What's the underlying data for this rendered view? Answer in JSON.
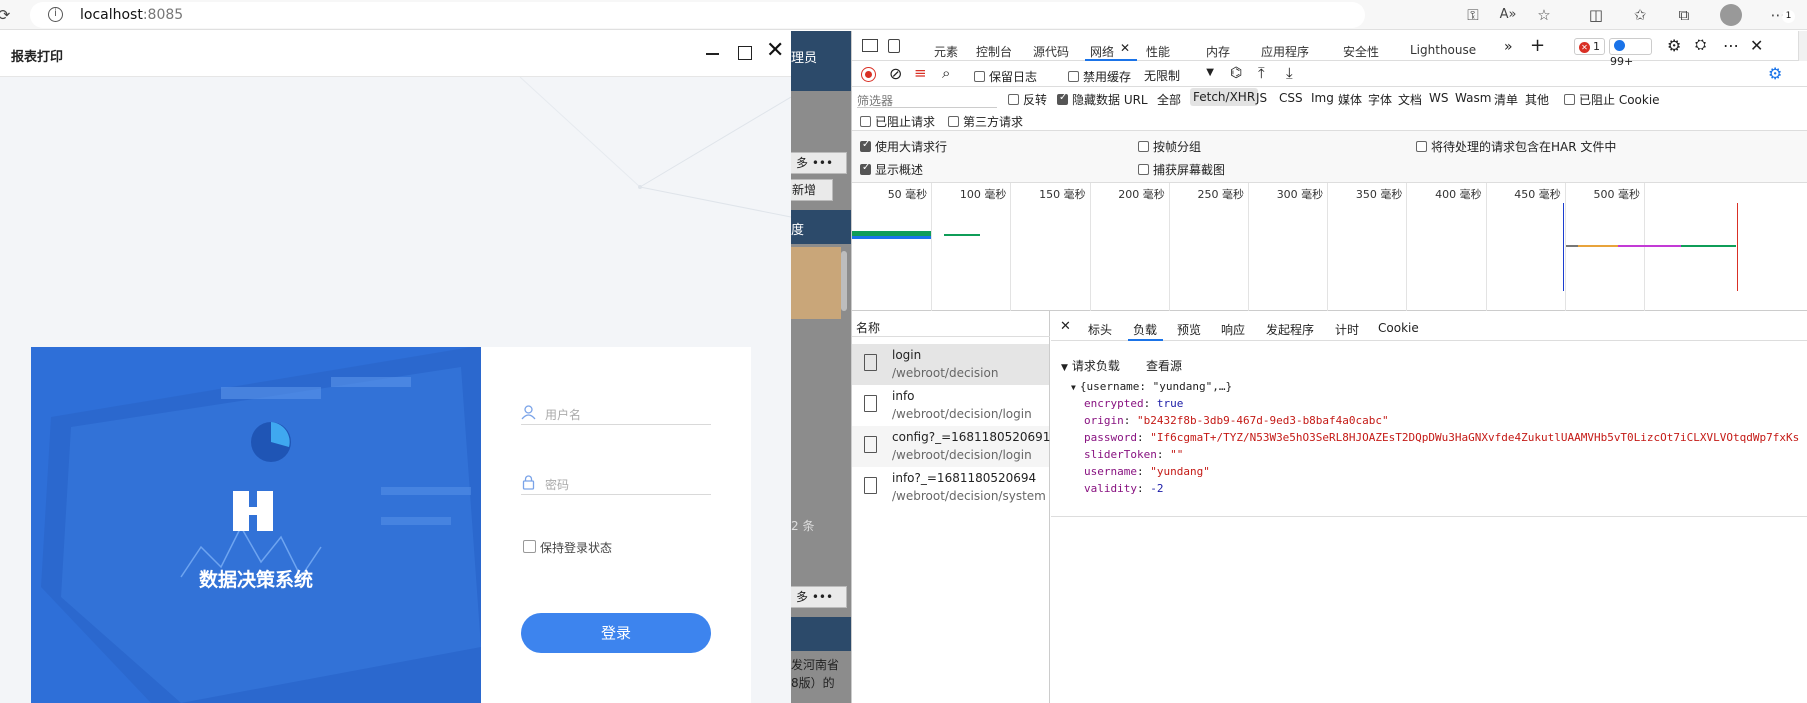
{
  "browser": {
    "url_host": "localhost",
    "url_port": ":8085",
    "refresh_icon": "refresh-icon",
    "info_icon": "info-icon",
    "toolbar_icons": [
      "key-icon",
      "read-aloud-icon",
      "favorite-add-icon",
      "split-screen-icon",
      "favorites-icon",
      "collections-icon",
      "profile-icon",
      "menu-icon"
    ],
    "badge_text": "1"
  },
  "dialog": {
    "title": "报表打印",
    "minimize_icon": "minimize-icon",
    "maximize_icon": "maximize-icon",
    "close_icon": "close-icon"
  },
  "background_page": {
    "fragments": [
      "理员",
      "多 •••",
      "新增",
      "度",
      "2 条",
      "多 •••",
      "发河南省",
      "8版）的"
    ]
  },
  "login": {
    "system_name": "数据决策系统",
    "username_placeholder": "用户名",
    "password_placeholder": "密码",
    "remember_label": "保持登录状态",
    "remember_checked": false,
    "login_button": "登录",
    "colors": {
      "accent": "#3d84ee",
      "panel": "#2e6fd8"
    }
  },
  "devtools": {
    "tabs": [
      "元素",
      "控制台",
      "源代码",
      "网络",
      "性能",
      "内存",
      "应用程序",
      "安全性",
      "Lighthouse"
    ],
    "active_tab": "网络",
    "error_count": "1",
    "message_count": "99+",
    "toolbar": {
      "preserve_log": "保留日志",
      "disable_cache": "禁用缓存",
      "throttling": "无限制"
    },
    "filter": {
      "placeholder": "筛选器",
      "invert": "反转",
      "hide_data_urls": "隐藏数据 URL",
      "types": [
        "全部",
        "Fetch/XHR",
        "JS",
        "CSS",
        "Img",
        "媒体",
        "字体",
        "文档",
        "WS",
        "Wasm",
        "清单",
        "其他"
      ],
      "active_type": "Fetch/XHR",
      "blocked_cookies": "已阻止 Cookie",
      "blocked_requests": "已阻止请求",
      "third_party": "第三方请求"
    },
    "options": {
      "big_rows": "使用大请求行",
      "group_by_frame": "按帧分组",
      "har_pending": "将待处理的请求包含在HAR 文件中",
      "show_overview": "显示概述",
      "capture_screenshots": "捕获屏幕截图"
    },
    "timeline_ticks": [
      "50 毫秒",
      "100 毫秒",
      "150 毫秒",
      "200 毫秒",
      "250 毫秒",
      "300 毫秒",
      "350 毫秒",
      "400 毫秒",
      "450 毫秒",
      "500 毫秒"
    ],
    "requests_header": "名称",
    "requests": [
      {
        "name": "login",
        "path": "/webroot/decision"
      },
      {
        "name": "info",
        "path": "/webroot/decision/login"
      },
      {
        "name": "config?_=1681180520691",
        "path": "/webroot/decision/login"
      },
      {
        "name": "info?_=1681180520694",
        "path": "/webroot/decision/system"
      }
    ],
    "detail_tabs": [
      "标头",
      "负载",
      "预览",
      "响应",
      "发起程序",
      "计时",
      "Cookie"
    ],
    "active_detail_tab": "负载",
    "payload": {
      "section_title": "请求负载",
      "view_source": "查看源",
      "summary": "{username: \"yundang\",…}",
      "fields": [
        {
          "key": "encrypted",
          "value": "true"
        },
        {
          "key": "origin",
          "value": "\"b2432f8b-3db9-467d-9ed3-b8baf4a0cabc\""
        },
        {
          "key": "password",
          "value": "\"If6cgmaT+/TYZ/N53W3e5hO3SeRL8HJOAZEsT2DQpDWu3HaGNXvfde4ZukutlUAAMVHb5vT0LizcOt7iCLXVLVOtqdWp7fxKs"
        },
        {
          "key": "sliderToken",
          "value": "\"\""
        },
        {
          "key": "username",
          "value": "\"yundang\""
        },
        {
          "key": "validity",
          "value": "-2"
        }
      ]
    }
  }
}
